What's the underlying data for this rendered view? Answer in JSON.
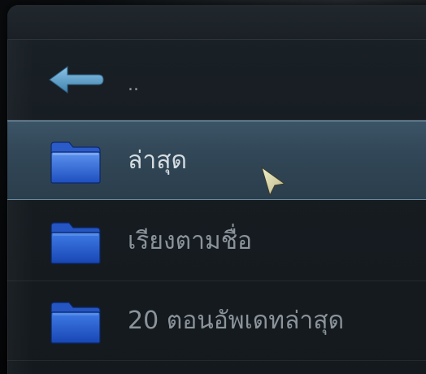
{
  "list": {
    "items": [
      {
        "label": "..",
        "icon": "back-arrow-icon"
      },
      {
        "label": "ล่าสุด",
        "icon": "folder-icon"
      },
      {
        "label": "เรียงตามชื่อ",
        "icon": "folder-icon"
      },
      {
        "label": "20 ตอนอัพเดทล่าสุด",
        "icon": "folder-icon"
      }
    ]
  },
  "colors": {
    "folder": "#2a63d6",
    "arrow": "#5f9fc8",
    "selection": "#34495a"
  }
}
